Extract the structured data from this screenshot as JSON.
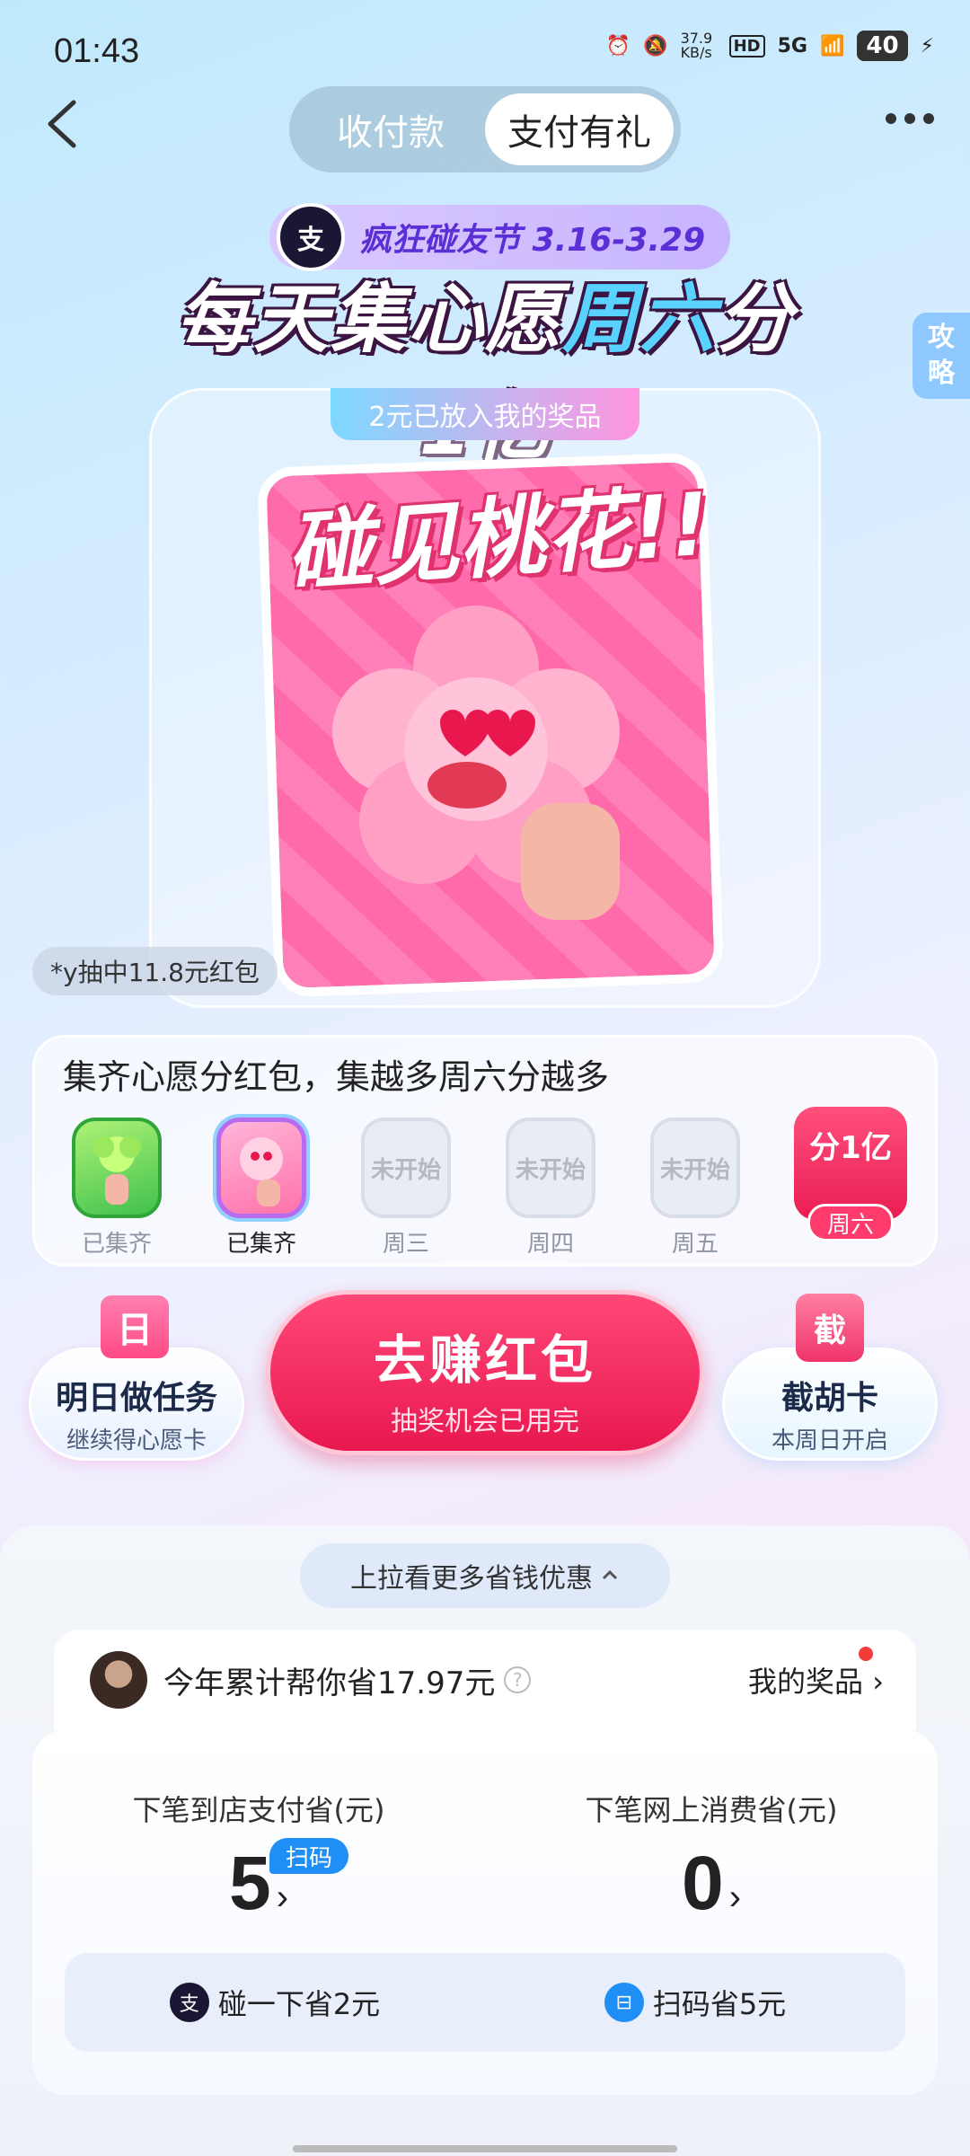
{
  "status": {
    "time": "01:43",
    "net_speed": "37.9 KB/s",
    "signal": "5G",
    "battery": "40"
  },
  "header": {
    "tabs": [
      "收付款",
      "支付有礼"
    ],
    "active_tab": 1
  },
  "festival": {
    "logo": "支",
    "badge": "疯狂碰友节 3.16-3.29",
    "headline_a": "每天集心愿",
    "headline_b": "周六",
    "headline_c": "分1亿"
  },
  "side_tab": "攻略",
  "card": {
    "prize_tag": "2元已放入我的奖品",
    "poster_title": "碰见桃花!!",
    "caption": "*y抽中11.8元红包"
  },
  "wish": {
    "title": "集齐心愿分红包，集越多周六分越多",
    "items": [
      {
        "label": "已集齐",
        "state": "green"
      },
      {
        "label": "已集齐",
        "state": "pink"
      },
      {
        "label": "周三",
        "state": "grey",
        "box_text": "未开始"
      },
      {
        "label": "周四",
        "state": "grey",
        "box_text": "未开始"
      },
      {
        "label": "周五",
        "state": "grey",
        "box_text": "未开始"
      }
    ],
    "saturday": {
      "top": "分1亿",
      "label": "周六"
    }
  },
  "actions": {
    "task": {
      "icon": "日",
      "title": "明日做任务",
      "sub": "继续得心愿卡"
    },
    "main": {
      "title": "去赚红包",
      "sub": "抽奖机会已用完"
    },
    "cut": {
      "icon": "截",
      "title": "截胡卡",
      "sub": "本周日开启"
    }
  },
  "sheet": {
    "pull": "上拉看更多省钱优惠",
    "saved_text": "今年累计帮你省17.97元",
    "my_prize": "我的奖品",
    "left_stat": {
      "label": "下笔到店支付省(元)",
      "value": "5",
      "badge": "扫码"
    },
    "right_stat": {
      "label": "下笔网上消费省(元)",
      "value": "0"
    },
    "tips": [
      {
        "text": "碰一下省2元"
      },
      {
        "text": "扫码省5元"
      }
    ]
  }
}
